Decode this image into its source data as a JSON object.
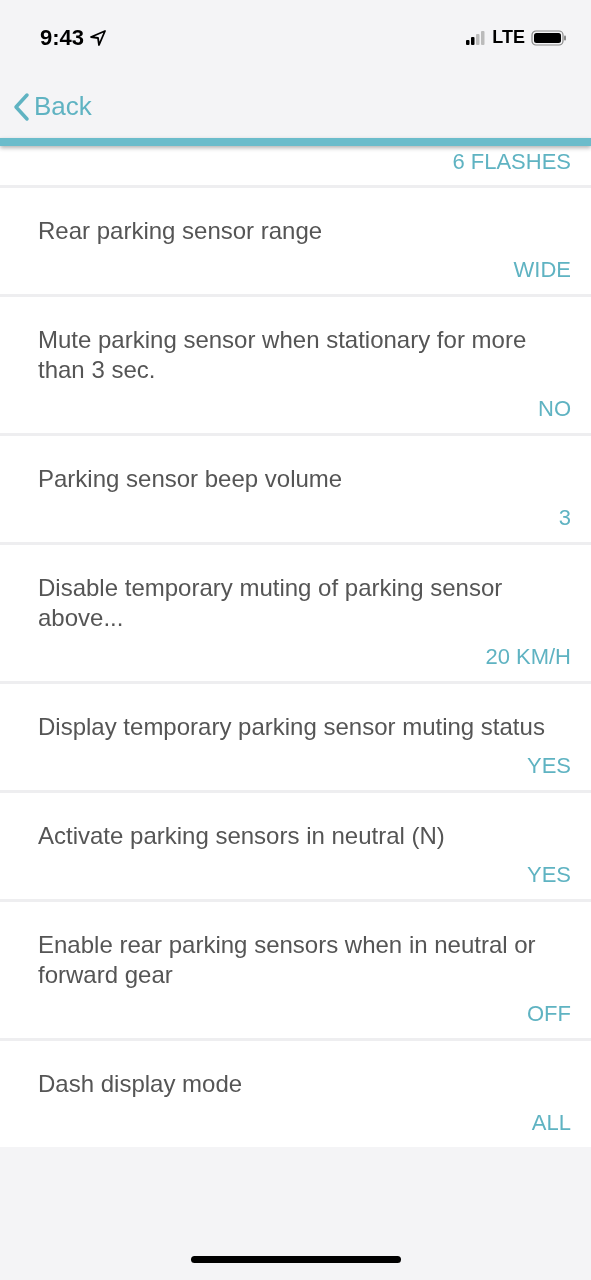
{
  "status_bar": {
    "time": "9:43",
    "network": "LTE"
  },
  "nav": {
    "back": "Back"
  },
  "settings": [
    {
      "value": "6 FLASHES"
    },
    {
      "label": "Rear parking sensor range",
      "value": "WIDE"
    },
    {
      "label": "Mute parking sensor when stationary for more than 3 sec.",
      "value": "NO"
    },
    {
      "label": "Parking sensor beep volume",
      "value": "3"
    },
    {
      "label": "Disable temporary muting of parking sensor above...",
      "value": "20 KM/H"
    },
    {
      "label": "Display temporary parking sensor muting status",
      "value": "YES"
    },
    {
      "label": "Activate parking sensors in neutral (N)",
      "value": "YES"
    },
    {
      "label": "Enable rear parking sensors when in neutral or forward gear",
      "value": "OFF"
    },
    {
      "label": "Dash display mode",
      "value": "ALL"
    }
  ]
}
